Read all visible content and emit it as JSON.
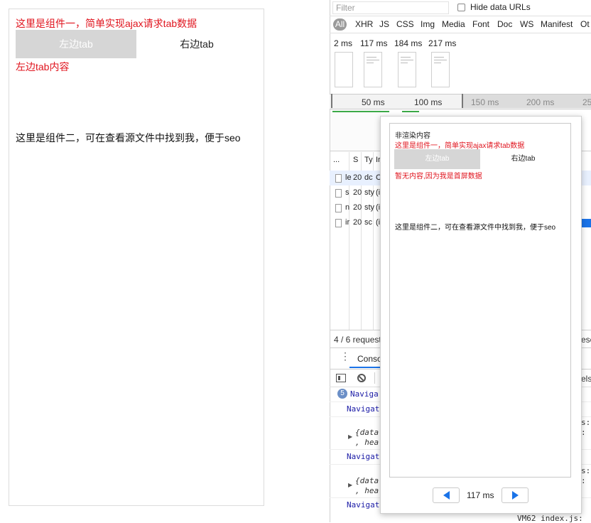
{
  "page": {
    "component1_text": "这里是组件一，简单实现ajax请求tab数据",
    "tab_left": "左边tab",
    "tab_right": "右边tab",
    "tab_content": "左边tab内容",
    "component2_text": "这里是组件二，可在查看源文件中找到我，便于seo"
  },
  "devtools": {
    "filter_placeholder": "Filter",
    "hide_data_urls": "Hide data URLs",
    "types": [
      "All",
      "XHR",
      "JS",
      "CSS",
      "Img",
      "Media",
      "Font",
      "Doc",
      "WS",
      "Manifest",
      "Ot"
    ],
    "filmstrip_times": [
      "2 ms",
      "117 ms",
      "184 ms",
      "217 ms"
    ],
    "timeline_labels": [
      "50 ms",
      "100 ms",
      "150 ms",
      "200 ms",
      "25"
    ],
    "table_headers": [
      "...",
      "S",
      "Ty",
      "Ir"
    ],
    "rows": [
      {
        "name": "le",
        "status": "20",
        "type": "dc",
        "init": "C"
      },
      {
        "name": "s",
        "status": "20",
        "type": "sty",
        "init": "(i"
      },
      {
        "name": "n",
        "status": "20",
        "type": "sty",
        "init": "(i"
      },
      {
        "name": "ir",
        "status": "20",
        "type": "sc",
        "init": "(i"
      }
    ],
    "summary": "4 / 6 request",
    "summary_right": "esc",
    "console_tab": "Conso",
    "levels_partial": "els",
    "console": {
      "badge": "5",
      "nav1": "Naviga",
      "nav2": "Navigat",
      "obj1_line1": "{data",
      "obj1_line2": ", hea",
      "nav3": "Navigat",
      "obj2_line1": "{data",
      "obj2_line2": ", hea",
      "nav4": "Navigat",
      "right1": "s:",
      "right2": ":",
      "right3": "s:",
      "right4": ":",
      "footer": "VM62 index.js:"
    }
  },
  "popover": {
    "not_rendered": "非渲染内容",
    "component1_text": "这里是组件一，简单实现ajax请求tab数据",
    "tab_left": "左边tab",
    "tab_right": "右边tab",
    "no_content": "暂无内容,因为我是首屏数据",
    "component2_text": "这里是组件二，可在查看源文件中找到我，便于seo",
    "time": "117 ms"
  },
  "colors": {
    "red": "#e0141e",
    "blue": "#1a73e8",
    "navy": "#1a1aa6",
    "tab_gray": "#d6d6d6"
  }
}
